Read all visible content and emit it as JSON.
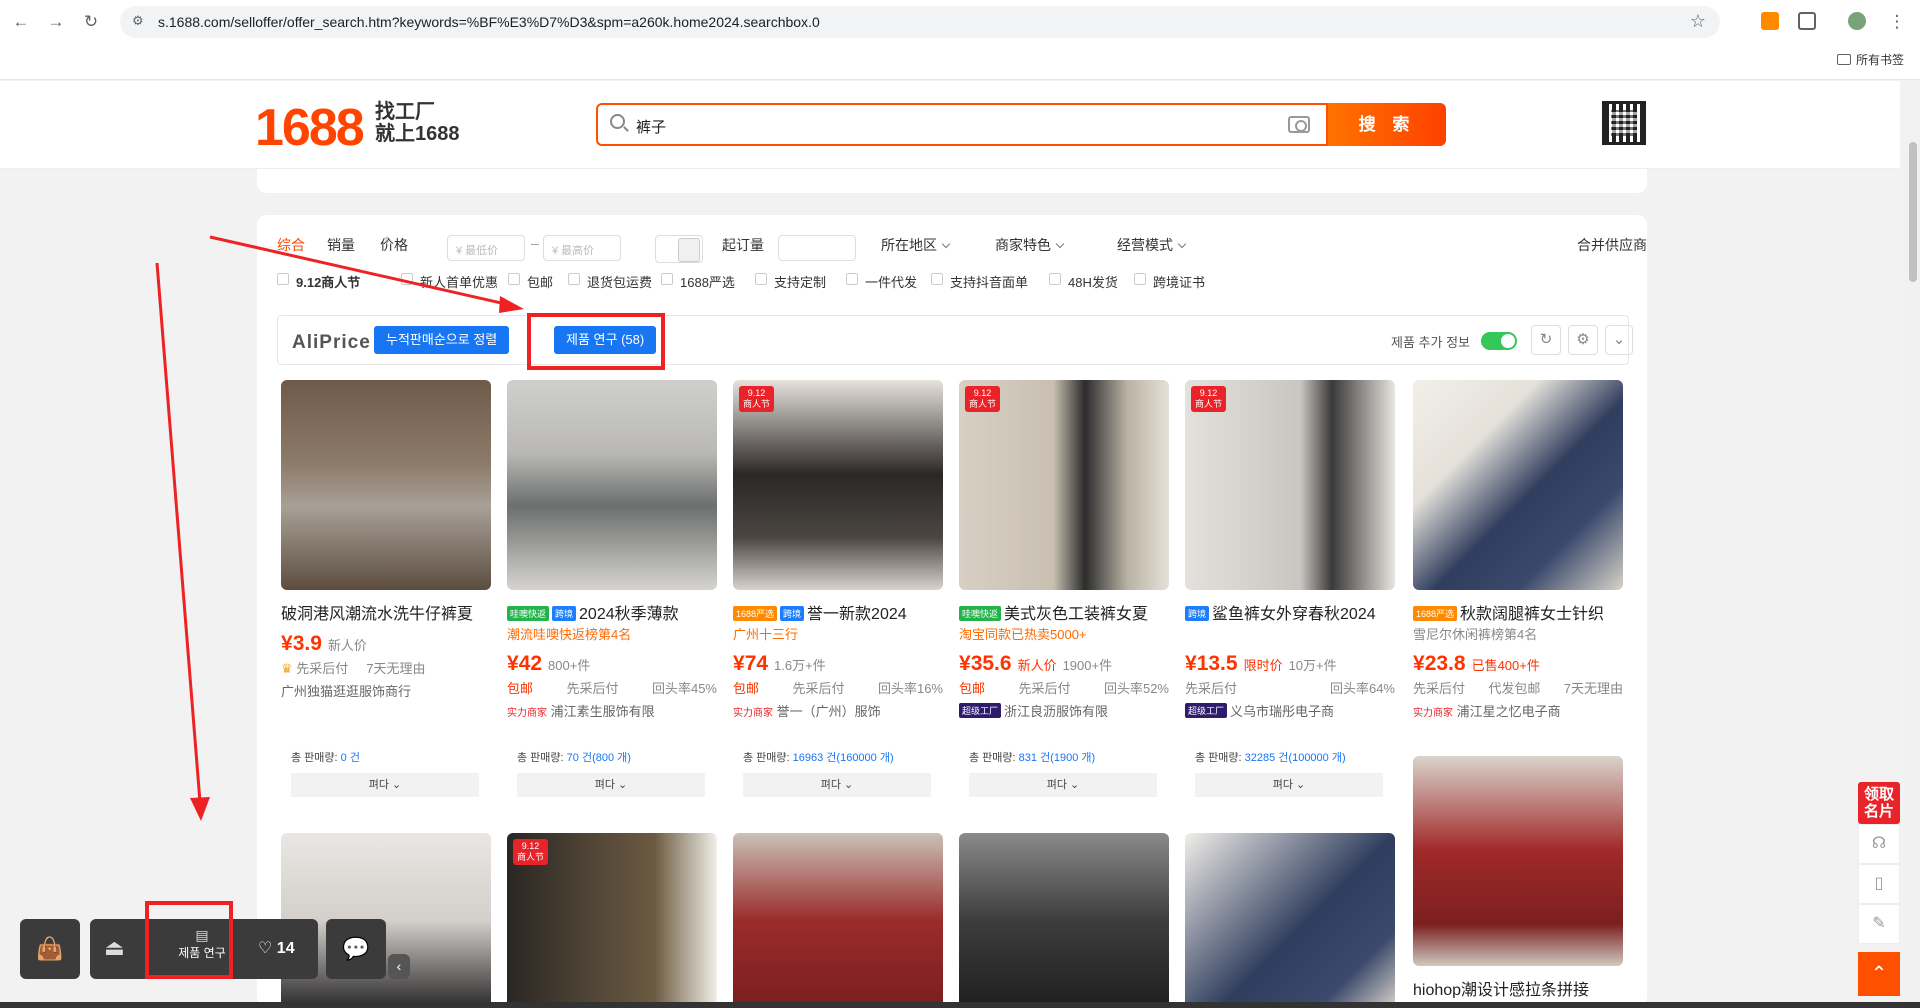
{
  "browser": {
    "url": "s.1688.com/selloffer/offer_search.htm?keywords=%BF%E3%D7%D3&spm=a260k.home2024.searchbox.0",
    "bookmarks_label": "所有书签"
  },
  "header": {
    "logo": "1688",
    "slogan1": "找工厂",
    "slogan2": "就上1688",
    "search_value": "裤子",
    "search_button": "搜 索"
  },
  "filters": {
    "sort_tabs": [
      "综合",
      "销量",
      "价格"
    ],
    "min_price_placeholder": "¥ 最低价",
    "max_price_placeholder": "¥ 最高价",
    "moq_label": "起订量",
    "dropdowns": [
      "所在地区",
      "商家特色",
      "经营模式"
    ],
    "merge_label": "合并供应商",
    "checks": [
      "9.12商人节",
      "新人首单优惠",
      "包邮",
      "退货包运费",
      "1688严选",
      "支持定制",
      "一件代发",
      "支持抖音面单",
      "48H发货",
      "跨境证书"
    ]
  },
  "aliprice": {
    "brand": "AliPrice",
    "sort_button": "누적판매순으로 정렬",
    "research_button": "제품 연구 (58)",
    "extra_info_label": "제품 추가 정보"
  },
  "products": [
    {
      "title": "破洞港风潮流水洗牛仔裤夏",
      "sub": "",
      "price": "3.9",
      "extra": "新人价",
      "meta_left": "先采后付",
      "meta_right": "7天无理由",
      "shop": "广州独猫逛逛服饰商行",
      "sales_label": "총 판매량:",
      "sales_value": "0 건",
      "fold": "펴다"
    },
    {
      "title": "2024秋季薄款",
      "sub": "潮流哇噢快返榜第4名",
      "price": "42",
      "extra": "800+件",
      "meta_left": "包邮",
      "meta_mid": "先采后付",
      "meta_right": "回头率45%",
      "shop": "浦江素生服饰有限",
      "shop_tag": "实力商家",
      "sales_label": "총 판매량:",
      "sales_value": "70 건(800 개)",
      "fold": "펴다"
    },
    {
      "title": "誉一新款2024",
      "sub": "广州十三行",
      "price": "74",
      "extra": "1.6万+件",
      "meta_left": "包邮",
      "meta_mid": "先采后付",
      "meta_right": "回头率16%",
      "shop": "誉一（广州）服饰",
      "shop_tag": "实力商家",
      "sales_label": "총 판매량:",
      "sales_value": "16963 건(160000 개)",
      "fold": "펴다"
    },
    {
      "title": "美式灰色工装裤女夏",
      "sub": "淘宝同款已热卖5000+",
      "price": "35.6",
      "extra_red": "新人价",
      "extra": "1900+件",
      "meta_left": "包邮",
      "meta_mid": "先采后付",
      "meta_right": "回头率52%",
      "shop": "浙江良沥服饰有限",
      "shop_tag": "超级工厂",
      "sales_label": "총 판매량:",
      "sales_value": "831 건(1900 개)",
      "fold": "펴다"
    },
    {
      "title": "鲨鱼裤女外穿春秋2024",
      "sub": "",
      "price": "13.5",
      "extra_red": "限时价",
      "extra": "10万+件",
      "meta_left": "先采后付",
      "meta_right": "回头率64%",
      "shop": "义乌市瑞彤电子商",
      "shop_tag": "超级工厂",
      "sales_label": "총 판매량:",
      "sales_value": "32285 건(100000 개)",
      "fold": "펴다"
    },
    {
      "title": "秋款阔腿裤女士针织",
      "sub": "雪尼尔休闲裤榜第4名",
      "price": "23.8",
      "extra_red": "已售400+件",
      "extra": "",
      "meta_left": "先采后付",
      "meta_mid": "代发包邮",
      "meta_right": "7天无理由",
      "shop": "浦江星之忆电子商",
      "shop_tag": "实力商家",
      "sales_label": "",
      "sales_value": "",
      "fold": ""
    },
    {
      "title": "hiohop潮设计感拉条拼接",
      "sub": "",
      "price": "",
      "extra": ""
    }
  ],
  "dock": {
    "research_label": "제품 연구",
    "likes": "14"
  },
  "side": {
    "coupon_label": "领取名片"
  }
}
